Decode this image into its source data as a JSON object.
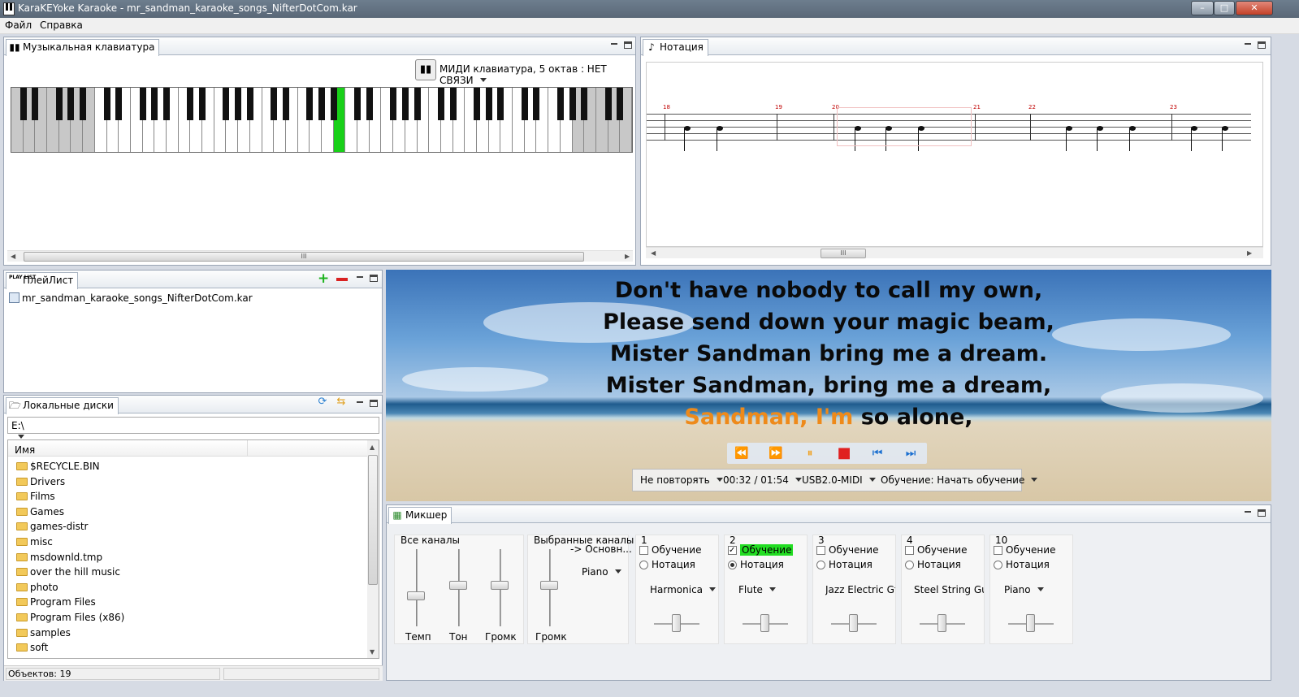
{
  "window": {
    "title": "KaraKEYoke Karaoke - mr_sandman_karaoke_songs_NifterDotCom.kar",
    "minimize_glyph": "–",
    "maximize_glyph": "□",
    "close_glyph": "✕"
  },
  "menu": [
    "Файл",
    "Справка"
  ],
  "keyboard_panel": {
    "tab": "Музыкальная клавиатура",
    "device": "МИДИ клавиатура, 5 октав : НЕТ СВЯЗИ",
    "scroll_glyph": "III"
  },
  "notation_panel": {
    "tab": "Нотация",
    "measures": [
      "18",
      "19",
      "20",
      "21",
      "22",
      "23"
    ]
  },
  "playlist_panel": {
    "tab": "ПлейЛист",
    "icon_text": "PLAY LIST",
    "items": [
      "mr_sandman_karaoke_songs_NifterDotCom.kar"
    ]
  },
  "disks_panel": {
    "tab": "Локальные диски",
    "drive": "E:\\",
    "column": "Имя",
    "folders": [
      "$RECYCLE.BIN",
      "Drivers",
      "Films",
      "Games",
      "games-distr",
      "misc",
      "msdownld.tmp",
      "over the hill music",
      "photo",
      "Program Files",
      "Program Files (x86)",
      "samples",
      "soft"
    ],
    "status": "Объектов: 19"
  },
  "lyrics": {
    "lines": [
      "Don't have nobody to call my own,",
      "Please send down your magic beam,",
      "Mister Sandman bring me a dream.",
      "Mister Sandman, bring me a dream,"
    ],
    "current_sung": "Sandman, I'm",
    "current_rest": " so alone,"
  },
  "transport": {
    "rewind": "⏪",
    "forward": "⏩",
    "pause": "⏸",
    "stop": "■",
    "prev": "⏮",
    "next": "⏭"
  },
  "player_status": {
    "repeat": "Не повторять",
    "time": "00:32 / 01:54",
    "device": "USB2.0-MIDI",
    "learning": "Обучение: Начать обучение"
  },
  "mixer": {
    "tab": "Микшер",
    "all_channels": {
      "title": "Все каналы",
      "labels": [
        "Темп",
        "Тон",
        "Громк"
      ],
      "levels": [
        0.42,
        0.57,
        0.57
      ]
    },
    "selected_channels": {
      "title": "Выбранные каналы",
      "target": "-> Основн...",
      "instrument": "Piano",
      "volume_label": "Громк",
      "level": 0.57
    },
    "learn_label": "Обучение",
    "notation_label": "Нотация",
    "channels": [
      {
        "number": "1",
        "learn": false,
        "notation": false,
        "instrument": "Harmonica",
        "balance": 0.5
      },
      {
        "number": "2",
        "learn": true,
        "notation": true,
        "instrument": "Flute",
        "balance": 0.5
      },
      {
        "number": "3",
        "learn": false,
        "notation": false,
        "instrument": "Jazz Electric Gtr",
        "balance": 0.5
      },
      {
        "number": "4",
        "learn": false,
        "notation": false,
        "instrument": "Steel String Guit",
        "balance": 0.5
      },
      {
        "number": "10",
        "learn": false,
        "notation": false,
        "instrument": "Piano",
        "balance": 0.5
      }
    ]
  },
  "colors": {
    "lyric_sung": "#ee8a1a",
    "pressed_key": "#18d018",
    "learn_highlight": "#22dd22",
    "transport_icon": "#1b6fd0",
    "stop_icon": "#e02020",
    "pause_icon": "#f0a020"
  }
}
